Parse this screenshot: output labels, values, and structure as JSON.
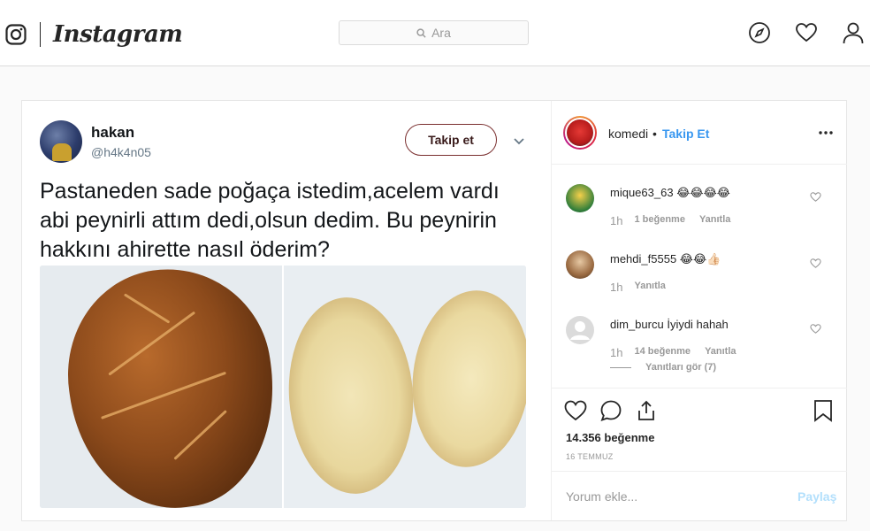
{
  "nav": {
    "brand": "Instagram",
    "search_placeholder": "Ara"
  },
  "tweet": {
    "name": "hakan",
    "handle": "@h4k4n05",
    "follow_label": "Takip et",
    "text": "Pastaneden sade poğaça istedim,acelem vardı abi peynirli attım dedi,olsun dedim. Bu peynirin hakkını ahirette nasıl öderim?"
  },
  "account": {
    "username": "komedi",
    "separator": "•",
    "follow_label": "Takip Et"
  },
  "comments": [
    {
      "username": "mique63_63",
      "text": "😂😂😂😂",
      "time": "1h",
      "likes": "1 beğenme",
      "reply": "Yanıtla"
    },
    {
      "username": "mehdi_f5555",
      "text": "😂😂👍🏻",
      "time": "1h",
      "reply": "Yanıtla"
    },
    {
      "username": "dim_burcu",
      "text": "İyiydi hahah",
      "time": "1h",
      "likes": "14 beğenme",
      "reply": "Yanıtla",
      "view_replies": "Yanıtları gör (7)"
    }
  ],
  "post": {
    "likes": "14.356 beğenme",
    "date": "16 TEMMUZ",
    "comment_placeholder": "Yorum ekle...",
    "post_label": "Paylaş"
  },
  "colors": {
    "link_blue": "#3897f0",
    "post_disabled": "#b2dffc",
    "follow_border": "#7a2f2f"
  }
}
